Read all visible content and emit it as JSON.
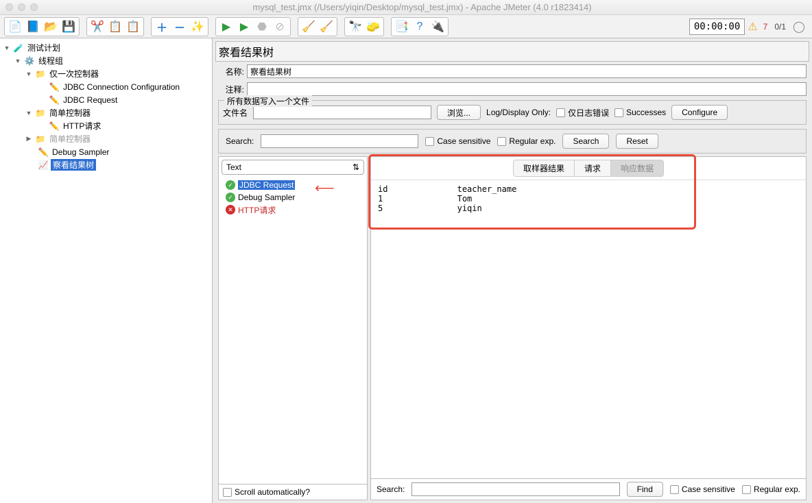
{
  "window": {
    "title": "mysql_test.jmx (/Users/yiqin/Desktop/mysql_test.jmx) - Apache JMeter (4.0 r1823414)"
  },
  "toolbar": {
    "timer": "00:00:00",
    "warn_count": "7",
    "thread_status": "0/1"
  },
  "tree": {
    "root": "测试计划",
    "thread_group": "线程组",
    "once_controller": "仅一次控制器",
    "jdbc_conn": "JDBC Connection Configuration",
    "jdbc_req": "JDBC Request",
    "simple_controller": "简单控制器",
    "http_req": "HTTP请求",
    "simple_controller2": "简单控制器",
    "debug_sampler": "Debug Sampler",
    "view_results": "察看结果树"
  },
  "panel": {
    "title": "察看结果树",
    "name_label": "名称:",
    "name_value": "察看结果树",
    "comment_label": "注释:",
    "fieldset_legend": "所有数据写入一个文件",
    "filename_label": "文件名",
    "browse_btn": "浏览...",
    "log_display": "Log/Display Only:",
    "errors_only": "仅日志错误",
    "successes": "Successes",
    "configure_btn": "Configure"
  },
  "search": {
    "label": "Search:",
    "case_sensitive": "Case sensitive",
    "regex": "Regular exp.",
    "search_btn": "Search",
    "reset_btn": "Reset"
  },
  "results": {
    "renderer": "Text",
    "items": [
      {
        "label": "JDBC Request",
        "ok": true,
        "selected": true
      },
      {
        "label": "Debug Sampler",
        "ok": true,
        "selected": false
      },
      {
        "label": "HTTP请求",
        "ok": false,
        "selected": false
      }
    ],
    "scroll_auto": "Scroll automatically?"
  },
  "tabs": {
    "sampler_result": "取样器结果",
    "request": "请求",
    "response_data": "响应数据"
  },
  "response": {
    "text": "id              teacher_name\n1               Tom\n5               yiqin"
  },
  "detail_search": {
    "label": "Search:",
    "find_btn": "Find",
    "case_sensitive": "Case sensitive",
    "regex": "Regular exp."
  }
}
